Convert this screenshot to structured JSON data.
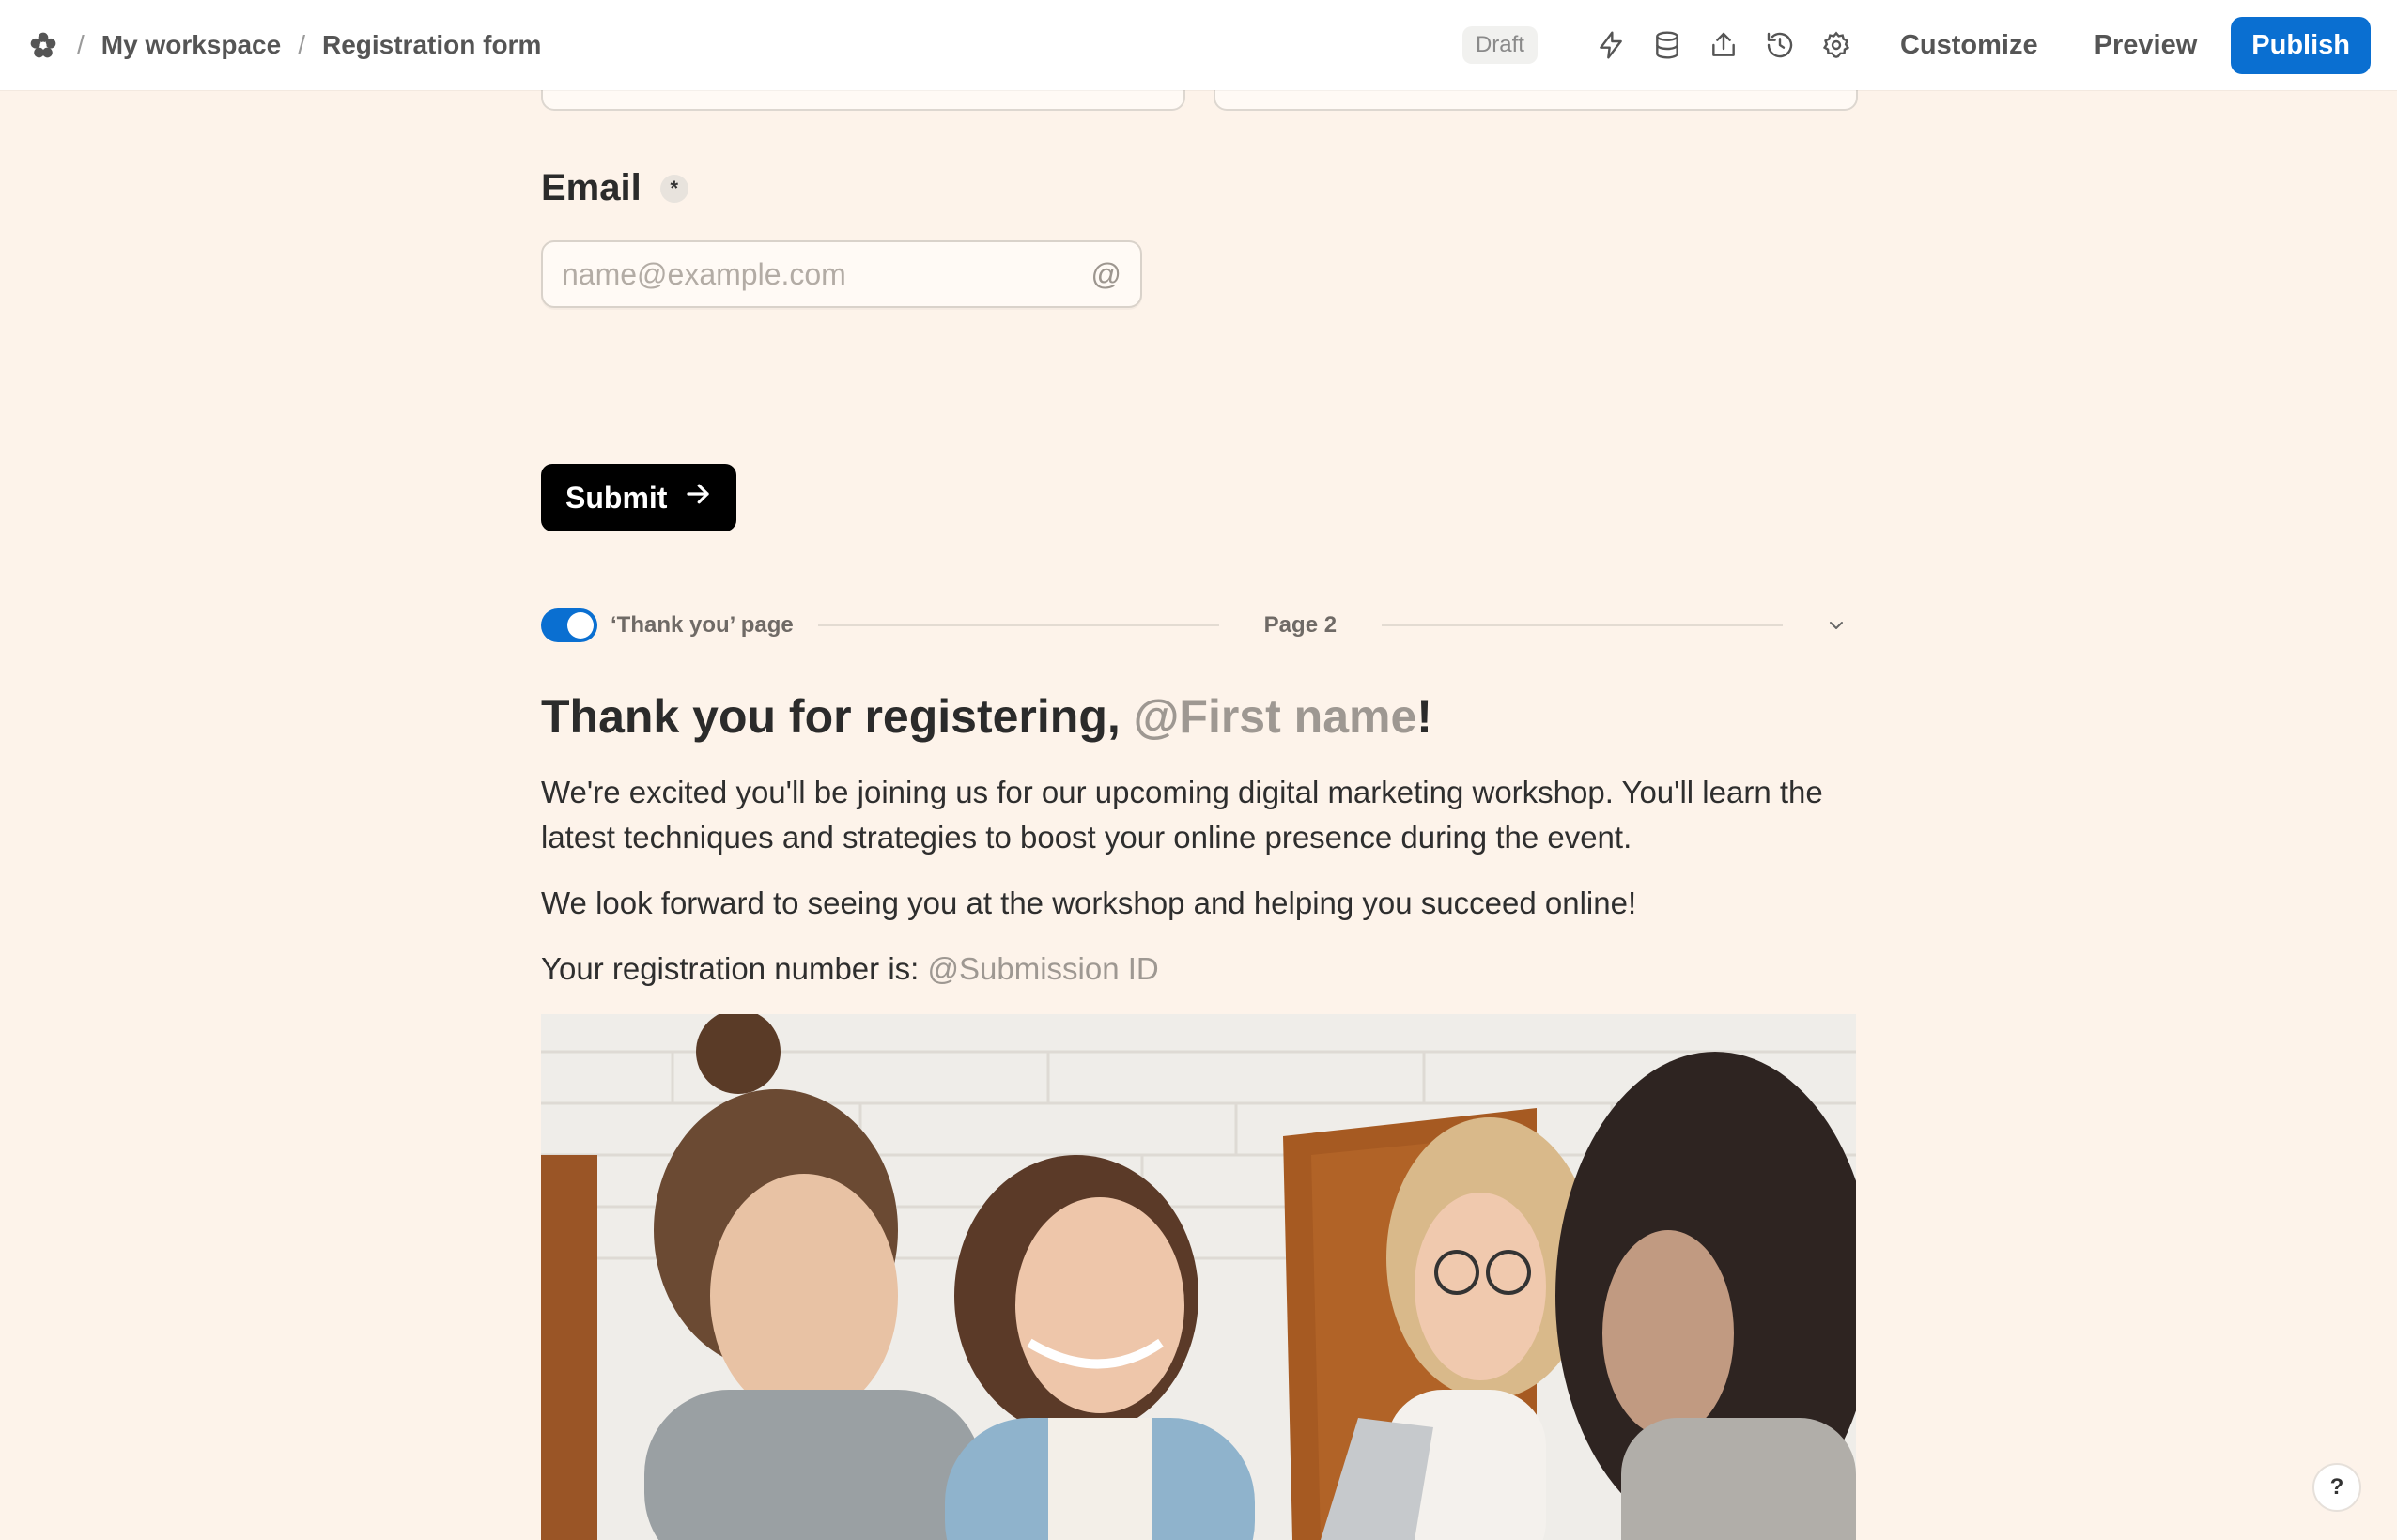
{
  "breadcrumb": {
    "workspace": "My workspace",
    "form": "Registration form"
  },
  "toolbar": {
    "status": "Draft",
    "customize_label": "Customize",
    "preview_label": "Preview",
    "publish_label": "Publish",
    "icons": [
      "automation-icon",
      "database-icon",
      "share-icon",
      "history-icon",
      "settings-icon"
    ]
  },
  "form": {
    "email_label": "Email",
    "email_required_marker": "*",
    "email_placeholder": "name@example.com",
    "submit_label": "Submit"
  },
  "thank_you": {
    "toggle_label": "‘Thank you’ page",
    "toggle_on": true,
    "page_label": "Page 2",
    "title_prefix": "Thank you for registering,",
    "title_mention": "@First name",
    "title_suffix": "!",
    "paragraph_1": "We're excited you'll be joining us for our upcoming digital marketing workshop. You'll learn the latest techniques and strategies to boost your online presence during the event.",
    "paragraph_2": "We look forward to seeing you at the workshop and helping you succeed online!",
    "paragraph_3_prefix": "Your registration number is:",
    "paragraph_3_mention": "@Submission ID"
  },
  "help_label": "?",
  "colors": {
    "background": "#fdf3ea",
    "accent": "#0a6fd1",
    "submit": "#000000",
    "mention": "#9e9892"
  }
}
